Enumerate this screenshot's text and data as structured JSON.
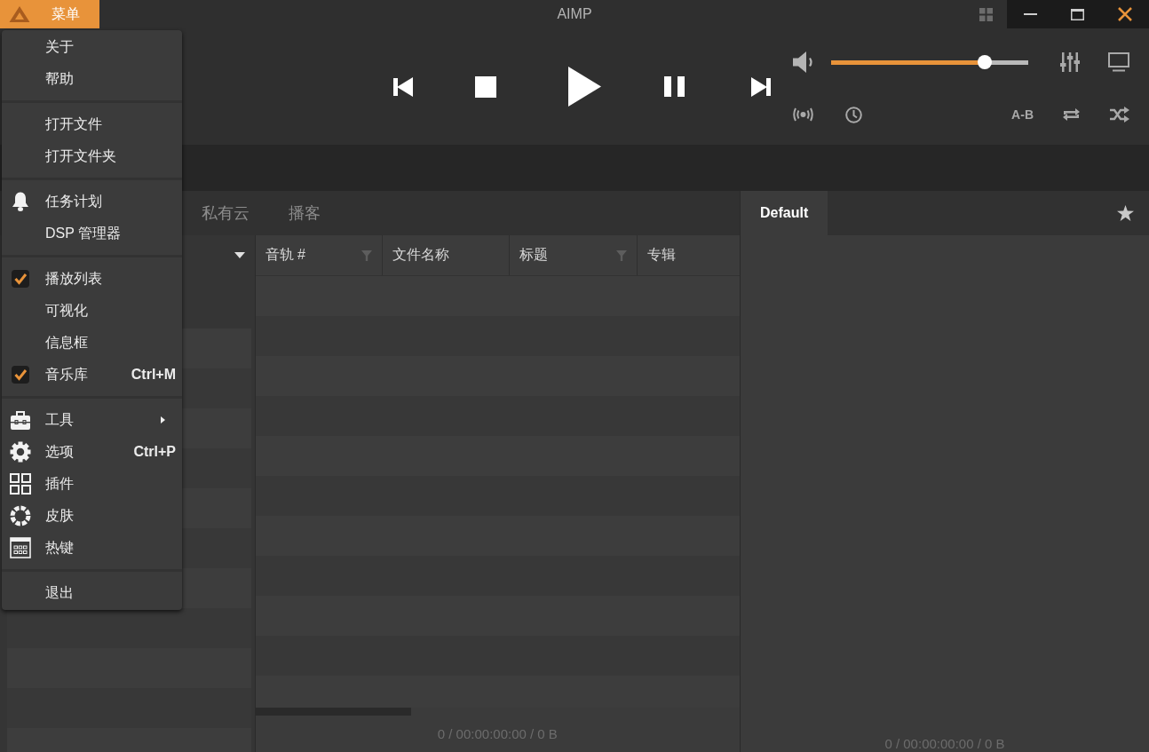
{
  "window": {
    "title": "AIMP"
  },
  "menu_button": {
    "label": "菜单"
  },
  "menu": {
    "groups": [
      [
        {
          "label": "关于"
        },
        {
          "label": "帮助"
        }
      ],
      [
        {
          "label": "打开文件"
        },
        {
          "label": "打开文件夹"
        }
      ],
      [
        {
          "label": "任务计划"
        },
        {
          "label": "DSP 管理器"
        }
      ],
      [
        {
          "label": "播放列表",
          "checked": true
        },
        {
          "label": "可视化",
          "checked": false
        },
        {
          "label": "信息框",
          "checked": false
        },
        {
          "label": "音乐库",
          "checked": true,
          "shortcut": "Ctrl+M"
        }
      ],
      [
        {
          "label": "工具",
          "submenu": true
        },
        {
          "label": "选项",
          "submenu": false,
          "shortcut": "Ctrl+P"
        },
        {
          "label": "插件",
          "submenu": false
        },
        {
          "label": "皮肤",
          "submenu": false
        },
        {
          "label": "热键",
          "submenu": false
        }
      ],
      [
        {
          "label": "退出"
        }
      ]
    ]
  },
  "player": {
    "volume": {
      "level": 0.78
    },
    "ab_repeat": {
      "label": "A-B"
    }
  },
  "library": {
    "tabs": [
      {
        "label": "私有云",
        "selected": false
      },
      {
        "label": "播客",
        "selected": false
      }
    ],
    "table": {
      "columns": [
        {
          "label": "音轨 #",
          "filter": true
        },
        {
          "label": "文件名称",
          "filter": false
        },
        {
          "label": "标题",
          "filter": true
        },
        {
          "label": "专辑",
          "filter": false
        }
      ]
    },
    "status": "0 / 00:00:00:00 / 0 B"
  },
  "playlists": {
    "tabs": [
      {
        "label": "Default",
        "selected": true
      }
    ],
    "status": "0 / 00:00:00:00 / 0 B"
  }
}
